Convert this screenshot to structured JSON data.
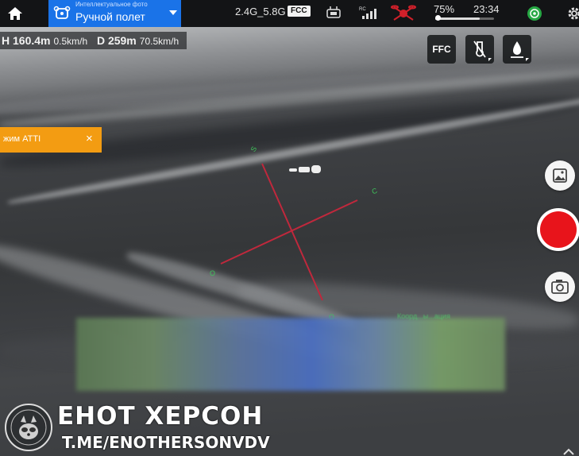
{
  "top_bar": {
    "mode": {
      "subtitle": "Интеллектуальное фото",
      "title": "Ручной полет"
    },
    "frequency": "2.4G_5.8G",
    "fcc_badge": "FCC",
    "battery_percent": "75%",
    "battery_level": 0.75,
    "time": "23:34",
    "icons": [
      "home-icon",
      "drone-mode-icon",
      "remote-controller-icon",
      "signal-bars-icon",
      "drone-status-icon",
      "gps-icon",
      "settings-icon"
    ]
  },
  "telemetry": {
    "height": "H 160.4m",
    "vertical_speed": "0.5km/h",
    "distance": "D 259m",
    "horizontal_speed": "70.5km/h"
  },
  "controls": {
    "ffc_label": "FFC",
    "palette_icon": "thermal-palette-icon",
    "gain_icon": "gain-icon"
  },
  "toast": {
    "text": "жим ATTI",
    "close": "×"
  },
  "overlay": {
    "green_text": "Коорд...ы...ация"
  },
  "watermark": {
    "title": "ЕНОТ ХЕРСОН",
    "link": "T.ME/ENOTHERSONVDV",
    "logo_text": "ДЕСАНТНЫЙ ЕНОТ ХЕРСОН"
  },
  "colors": {
    "accent_blue": "#1a73e8",
    "toast_orange": "#f39c12",
    "record_red": "#e8141b",
    "crosshair_red": "#c0283c",
    "marker_green": "#3ec45a"
  }
}
